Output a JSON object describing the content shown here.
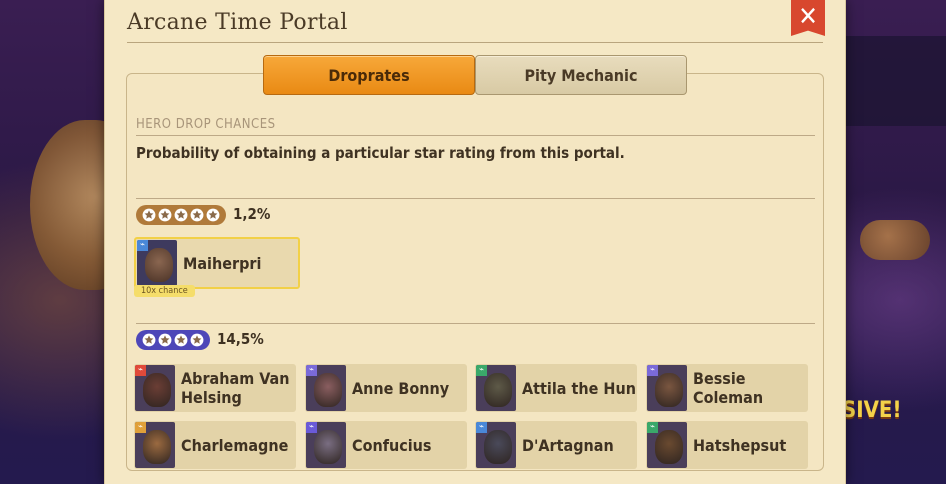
{
  "window": {
    "title": "Arcane Time Portal",
    "close_label": "✕"
  },
  "tabs": [
    {
      "label": "Droprates",
      "active": true
    },
    {
      "label": "Pity Mechanic",
      "active": false
    }
  ],
  "section": {
    "heading": "HERO DROP CHANCES",
    "description": "Probability of obtaining a particular star rating from this portal."
  },
  "tiers": [
    {
      "stars": 5,
      "percent": "1,2%",
      "color": "#b07a3a",
      "heroes": [
        {
          "name": "Maiherpri",
          "badge": "10x chance",
          "tone": "#6a4a3a"
        }
      ]
    },
    {
      "stars": 4,
      "percent": "14,5%",
      "color": "#4e47b8",
      "heroes": [
        {
          "name": "Abraham Van Helsing",
          "tone": "#6b3e35"
        },
        {
          "name": "Anne Bonny",
          "tone": "#8a5e60"
        },
        {
          "name": "Attila the Hun",
          "tone": "#5e5a48"
        },
        {
          "name": "Bessie Coleman",
          "tone": "#7a5640"
        },
        {
          "name": "Charlemagne",
          "tone": "#9b6a40"
        },
        {
          "name": "Confucius",
          "tone": "#7a6e82"
        },
        {
          "name": "D'Artagnan",
          "tone": "#4a4a5a"
        },
        {
          "name": "Hatshepsut",
          "tone": "#6a4a30"
        }
      ]
    }
  ],
  "background": {
    "banner_fragment": "SIVE!"
  }
}
